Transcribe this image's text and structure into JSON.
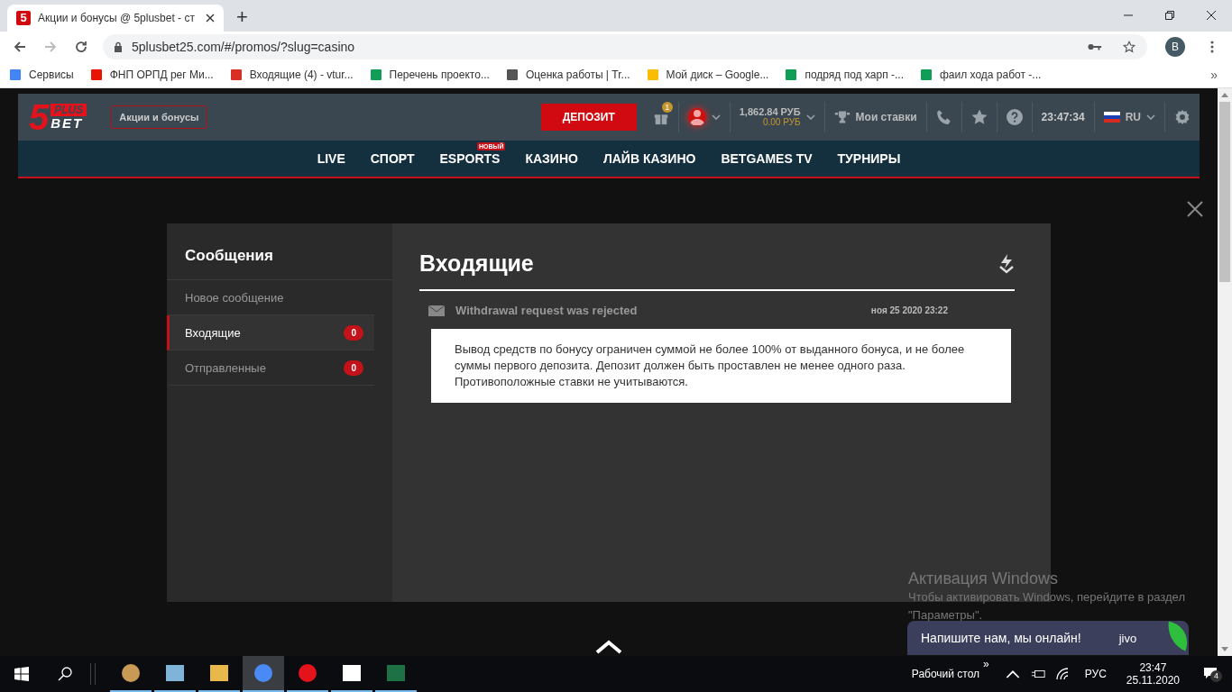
{
  "browser": {
    "tab_title": "Акции и бонусы @ 5plusbet - ст",
    "tab_favicon": "5",
    "new_tab": "+",
    "url": "5plusbet25.com/#/promos/?slug=casino",
    "profile": "B",
    "bookmarks": [
      {
        "label": "Сервисы",
        "kind": "apps"
      },
      {
        "label": "ФНП ОРПД рег Ми...",
        "kind": "yandex"
      },
      {
        "label": "Входящие (4) - vtur...",
        "kind": "gmail"
      },
      {
        "label": "Перечень проекто...",
        "kind": "sheet"
      },
      {
        "label": "Оценка работы | Tr...",
        "kind": "doc"
      },
      {
        "label": "Мой диск – Google...",
        "kind": "drive"
      },
      {
        "label": "подряд под харп -...",
        "kind": "sheet"
      },
      {
        "label": "фаил хода работ -...",
        "kind": "sheet"
      }
    ],
    "more_bookmarks": "»"
  },
  "header": {
    "logo_top": "PLUS",
    "logo_digit": "5",
    "logo_bottom": "BET",
    "promo_button": "Акции и бонусы",
    "deposit_button": "ДЕПОЗИТ",
    "gift_count": "1",
    "balance": "1,862.84 РУБ",
    "bonus_balance": "0.00 РУБ",
    "my_bets": "Мои ставки",
    "clock": "23:47:34",
    "language": "RU"
  },
  "nav": [
    {
      "label": "LIVE"
    },
    {
      "label": "СПОРТ"
    },
    {
      "label": "ESPORTS",
      "badge": "НОВЫЙ"
    },
    {
      "label": "КАЗИНО"
    },
    {
      "label": "ЛАЙВ КАЗИНО"
    },
    {
      "label": "BETGAMES TV"
    },
    {
      "label": "ТУРНИРЫ"
    }
  ],
  "messages": {
    "sidebar_title": "Сообщения",
    "items": [
      {
        "label": "Новое сообщение",
        "selected": false
      },
      {
        "label": "Входящие",
        "count": "0",
        "selected": true
      },
      {
        "label": "Отправленные",
        "count": "0",
        "selected": false
      }
    ],
    "heading": "Входящие",
    "message": {
      "subject": "Withdrawal request was rejected",
      "date": "ноя 25 2020 23:22",
      "body": "Вывод средств по бонусу ограничен суммой не более 100% от выданного бонуса, и не более суммы первого депозита. Депозит должен быть проставлен не менее одного раза. Противоположные ставки не учитываются."
    }
  },
  "activation": {
    "title": "Активация Windows",
    "text": "Чтобы активировать Windows, перейдите в раздел \"Параметры\"."
  },
  "chat": {
    "text": "Напишите нам, мы онлайн!",
    "brand": "jivo"
  },
  "taskbar": {
    "apps": [
      {
        "kind": "paint",
        "active": false
      },
      {
        "kind": "notepad",
        "active": false
      },
      {
        "kind": "folder",
        "active": false
      },
      {
        "kind": "chrome",
        "active": true
      },
      {
        "kind": "opera",
        "active": false
      },
      {
        "kind": "photos",
        "active": false
      },
      {
        "kind": "excel",
        "active": false
      }
    ],
    "desktop": "Рабочий стол",
    "chevrons": "»",
    "lang": "РУС",
    "time": "23:47",
    "date": "25.11.2020",
    "notifications": "4"
  }
}
